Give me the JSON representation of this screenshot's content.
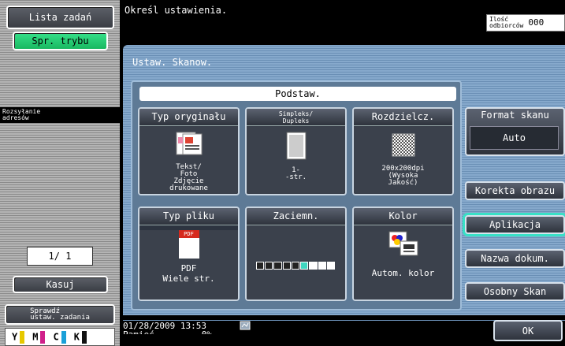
{
  "left": {
    "job_list": "Lista zadań",
    "mode_check": "Spr. trybu",
    "address_send": "Rozsyłanie\nadresów",
    "page_counter": "1/  1",
    "clear": "Kasuj",
    "check_job_settings": "Sprawdź\nustaw. zadania",
    "toner": [
      {
        "label": "Y",
        "color": "#e6c800"
      },
      {
        "label": "M",
        "color": "#d0208a"
      },
      {
        "label": "C",
        "color": "#1aa0d8"
      },
      {
        "label": "K",
        "color": "#111111"
      }
    ]
  },
  "top": {
    "message": "Określ ustawienia.",
    "recipients_label": "Ilość\nodbiorców",
    "recipients_count": "000"
  },
  "panel": {
    "title": "Ustaw. Skanow.",
    "section": "Podstaw."
  },
  "tiles": {
    "original_type": {
      "title": "Typ oryginału",
      "value": "Tekst/\nFoto\nZdjęcie\ndrukowane",
      "icon": "document-photo-icon"
    },
    "simplex_duplex": {
      "title": "Simpleks/\nDupleks",
      "value": "1-\n-str.",
      "icon": "single-page-icon"
    },
    "resolution": {
      "title": "Rozdzielcz.",
      "value": "200x200dpi\n(Wysoka\nJakość)",
      "icon": "resolution-grid-icon"
    },
    "file_type": {
      "title": "Typ pliku",
      "value": "PDF\nWiele str.",
      "icon": "pdf-file-icon",
      "badge": "PDF"
    },
    "density": {
      "title": "Zaciemn.",
      "level": 6,
      "steps": 9,
      "icon": "density-scale-icon"
    },
    "color": {
      "title": "Kolor",
      "value": "Autom. kolor",
      "icon": "auto-color-icon"
    }
  },
  "right": {
    "scan_format_label": "Format skanu",
    "scan_format_value": "Auto",
    "image_correction": "Korekta obrazu",
    "application": "Aplikacja",
    "document_name": "Nazwa dokum.",
    "separate_scan": "Osobny Skan",
    "ok": "OK"
  },
  "footer": {
    "datetime": "01/28/2009   13:53",
    "memory_label": "Pamięć",
    "memory_value": "0%",
    "icon": "network-icon"
  }
}
